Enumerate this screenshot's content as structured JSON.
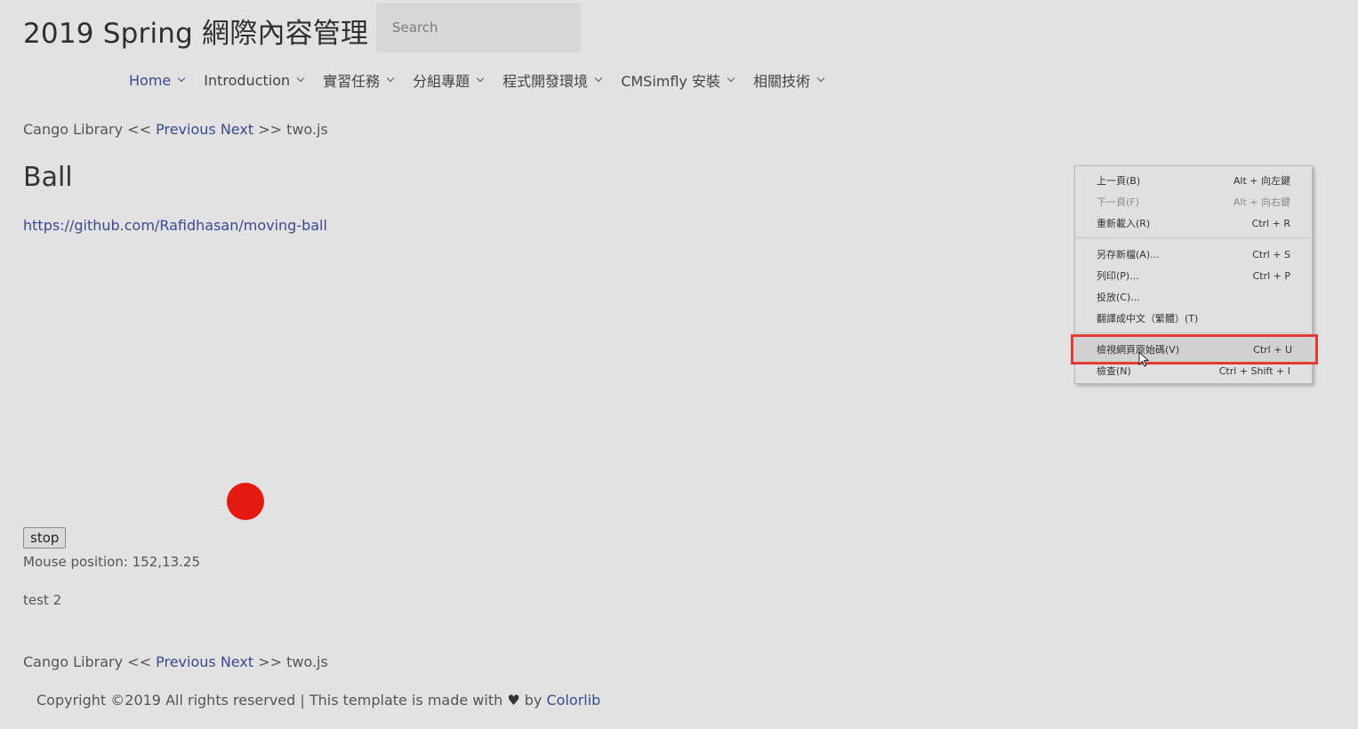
{
  "header": {
    "site_title": "2019 Spring 網際內容管理",
    "search_placeholder": "Search"
  },
  "nav": {
    "items": [
      {
        "label": "Home"
      },
      {
        "label": "Introduction"
      },
      {
        "label": "實習任務"
      },
      {
        "label": "分組專題"
      },
      {
        "label": "程式開發環境"
      },
      {
        "label": "CMSimfly 安裝"
      },
      {
        "label": "相關技術"
      }
    ]
  },
  "breadcrumb": {
    "prefix": "Cango Library <<",
    "previous": "Previous",
    "next": "Next",
    "suffix": ">> two.js"
  },
  "main": {
    "title": "Ball",
    "link": "https://github.com/Rafidhasan/moving-ball",
    "ball_color": "#e41b10",
    "stop_label": "stop",
    "mouse_position": "Mouse position: 152,13.25",
    "test_text": "test 2"
  },
  "footer": {
    "text_before": "Copyright ©2019 All rights reserved | This template is made with",
    "heart": "♥",
    "text_by": "by",
    "link": "Colorlib"
  },
  "context_menu": {
    "items": [
      {
        "label": "上一頁(B)",
        "shortcut": "Alt + 向左鍵"
      },
      {
        "label": "下一頁(F)",
        "shortcut": "Alt + 向右鍵"
      },
      {
        "label": "重新載入(R)",
        "shortcut": "Ctrl + R"
      },
      {
        "label": "另存新檔(A)...",
        "shortcut": "Ctrl + S"
      },
      {
        "label": "列印(P)...",
        "shortcut": "Ctrl + P"
      },
      {
        "label": "投放(C)...",
        "shortcut": ""
      },
      {
        "label": "翻譯成中文（繁體）(T)",
        "shortcut": ""
      },
      {
        "label": "檢視網頁原始碼(V)",
        "shortcut": "Ctrl + U"
      },
      {
        "label": "檢查(N)",
        "shortcut": "Ctrl + Shift + I"
      }
    ],
    "highlight_color": "#e53935"
  }
}
